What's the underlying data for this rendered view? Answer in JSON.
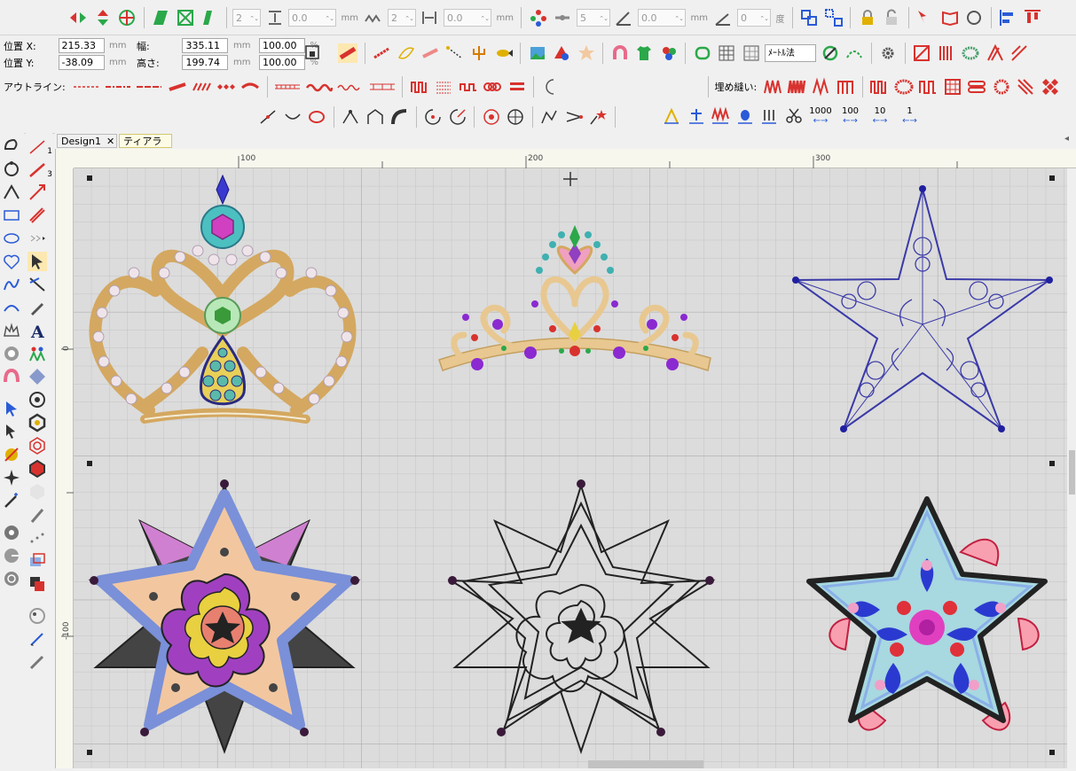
{
  "toolbar1": {
    "stepper_a": "2",
    "stepper_b": "0.0",
    "unit_mm": "mm",
    "stepper_c": "2",
    "stepper_d": "0.0",
    "stepper_e": "5",
    "stepper_f": "0.0",
    "stepper_g": "0",
    "unit_deg": "度"
  },
  "position": {
    "x_label": "位置 X:",
    "x_value": "215.33",
    "y_label": "位置 Y:",
    "y_value": "-38.09",
    "w_label": "幅:",
    "w_value": "335.11",
    "h_label": "高さ:",
    "h_value": "199.74",
    "w_pct": "100.00",
    "h_pct": "100.00",
    "unit_mm": "mm",
    "unit_pct": "%"
  },
  "toolbar2": {
    "method_select": "ﾒｰﾄﾙ法"
  },
  "toolbar3": {
    "outline_label": "アウトライン:",
    "fill_label": "埋め縫い:"
  },
  "toolbar4": {
    "count_1000": "1000",
    "count_100": "100",
    "count_10": "10",
    "count_1": "1"
  },
  "left_tools": {
    "step1": "1",
    "step3": "3"
  },
  "tabs": [
    {
      "label": "Design1"
    },
    {
      "label": "ティアラ"
    }
  ],
  "ruler": {
    "h_100": "100",
    "h_200": "200",
    "h_300": "300",
    "v_0": "0",
    "v_neg100": "-100"
  },
  "colors": {
    "accent_red": "#d8322e",
    "accent_blue": "#2a5bd7",
    "grid": "#cfcfcf",
    "star_blue": "#3a3aa8"
  }
}
